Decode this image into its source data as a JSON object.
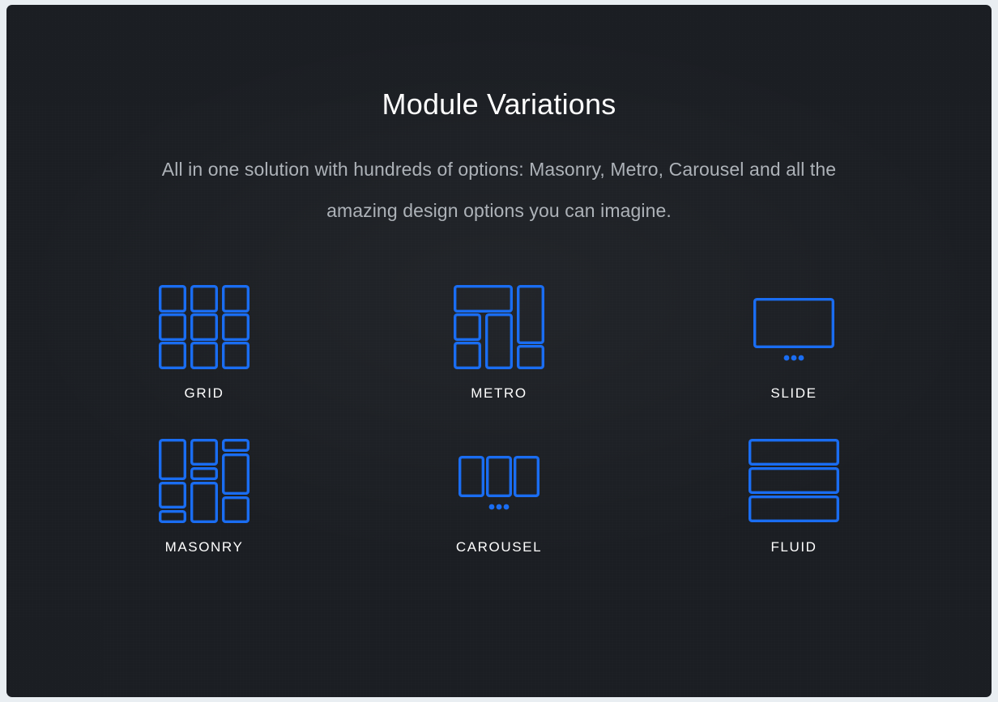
{
  "header": {
    "title": "Module Variations",
    "subtitle": "All in one solution with hundreds of options: Masonry, Metro, Carousel and all the amazing design options you can imagine."
  },
  "theme": {
    "background": "#1b1e23",
    "accent": "#1a6df2",
    "title_color": "#ffffff",
    "subtitle_color": "#adb2b8",
    "label_color": "#ffffff"
  },
  "modules": [
    {
      "id": "grid",
      "label": "GRID",
      "icon": "grid-layout-icon"
    },
    {
      "id": "metro",
      "label": "METRO",
      "icon": "metro-layout-icon"
    },
    {
      "id": "slide",
      "label": "SLIDE",
      "icon": "slide-layout-icon"
    },
    {
      "id": "masonry",
      "label": "MASONRY",
      "icon": "masonry-layout-icon"
    },
    {
      "id": "carousel",
      "label": "CAROUSEL",
      "icon": "carousel-layout-icon"
    },
    {
      "id": "fluid",
      "label": "FLUID",
      "icon": "fluid-layout-icon"
    }
  ]
}
